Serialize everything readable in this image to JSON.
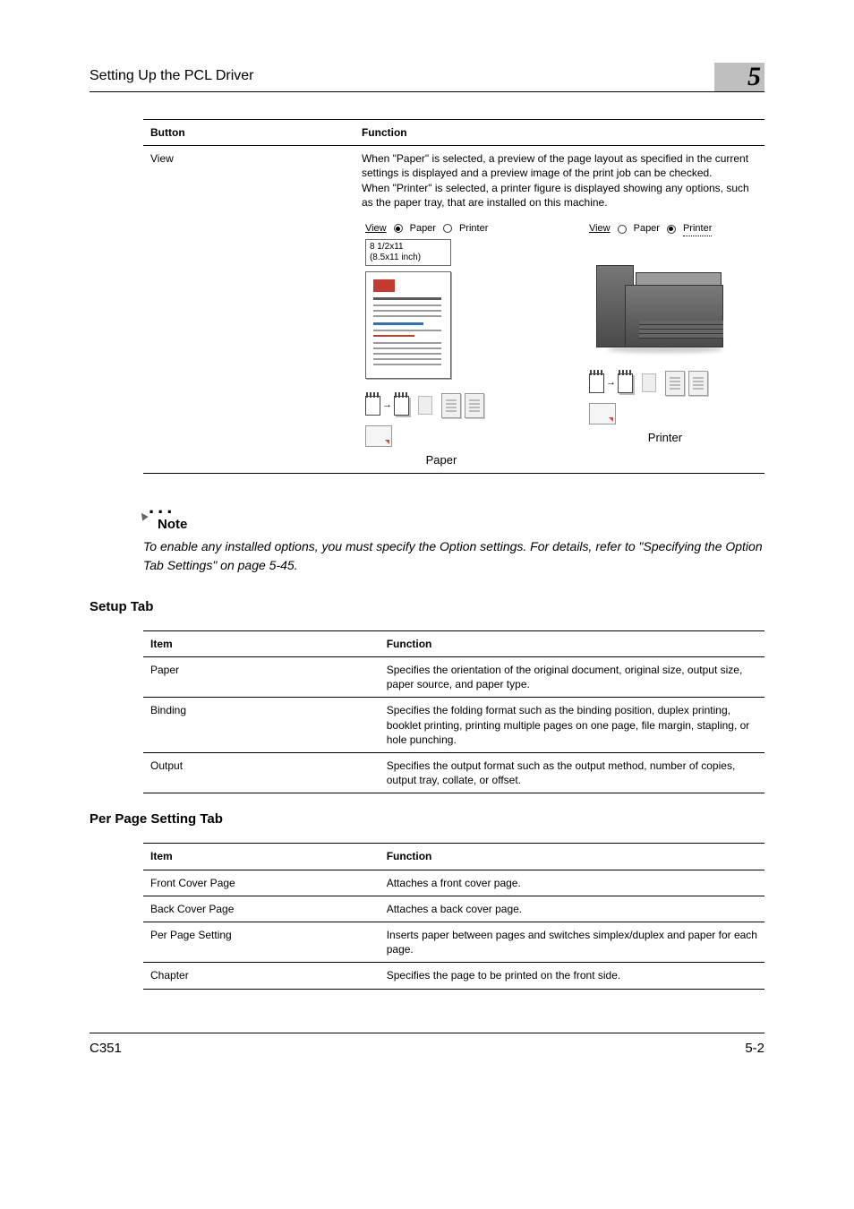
{
  "header": {
    "title": "Setting Up the PCL Driver",
    "chapter": "5"
  },
  "table1": {
    "col_button": "Button",
    "col_function": "Function",
    "row_button": "View",
    "row_function": "When \"Paper\" is selected, a preview of the page layout as specified in the current settings is displayed and a preview image of the print job can be checked.\nWhen \"Printer\" is selected, a printer figure is displayed showing any options, such as the paper tray, that are installed on this machine.",
    "preview": {
      "view_label": "View",
      "paper_label": "Paper",
      "printer_label": "Printer",
      "size_line1": "8 1/2x11",
      "size_line2": "(8.5x11 inch)",
      "caption_paper": "Paper",
      "caption_printer": "Printer"
    }
  },
  "note": {
    "label": "Note",
    "text": "To enable any installed options, you must specify the Option settings. For details, refer to \"Specifying the Option Tab Settings\" on page 5-45."
  },
  "setup": {
    "title": "Setup Tab",
    "col_item": "Item",
    "col_function": "Function",
    "rows": [
      {
        "item": "Paper",
        "fn": "Specifies the orientation of the original document, original size, output size, paper source, and paper type."
      },
      {
        "item": "Binding",
        "fn": "Specifies the folding format such as the binding position, duplex printing, booklet printing, printing multiple pages on one page, file margin, stapling, or hole punching."
      },
      {
        "item": "Output",
        "fn": "Specifies the output format such as the output method, number of copies, output tray, collate, or offset."
      }
    ]
  },
  "perpage": {
    "title": "Per Page Setting Tab",
    "col_item": "Item",
    "col_function": "Function",
    "rows": [
      {
        "item": "Front Cover Page",
        "fn": "Attaches a front cover page."
      },
      {
        "item": "Back Cover Page",
        "fn": "Attaches a back cover page."
      },
      {
        "item": "Per Page Setting",
        "fn": "Inserts paper between pages and switches simplex/duplex and paper for each page."
      },
      {
        "item": "Chapter",
        "fn": "Specifies the page to be printed on the front side."
      }
    ]
  },
  "footer": {
    "model": "C351",
    "page": "5-2"
  }
}
